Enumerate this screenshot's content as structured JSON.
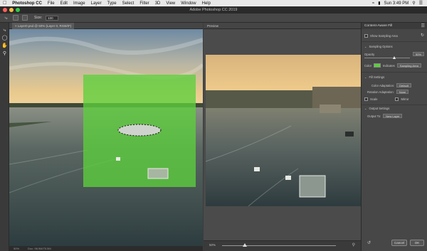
{
  "menubar": {
    "app_name": "Photoshop CC",
    "items": [
      "File",
      "Edit",
      "Image",
      "Layer",
      "Type",
      "Select",
      "Filter",
      "3D",
      "View",
      "Window",
      "Help"
    ],
    "clock": "Sun 3:49 PM"
  },
  "window": {
    "title": "Adobe Photoshop CC 2019"
  },
  "options_bar": {
    "size_label": "Size:",
    "size_value": "100"
  },
  "document": {
    "tab_label": "Layer0.psd @ 50% (Layer 0, RGB/8*)",
    "zoom": "50%",
    "doc_info": "Doc: 98.9M/75.5M"
  },
  "preview": {
    "tab_label": "Preview",
    "zoom": "50%"
  },
  "panel": {
    "title": "Content-Aware Fill",
    "show_sampling_area": "Show Sampling Area",
    "sampling_options_header": "Sampling Options",
    "opacity_label": "Opacity",
    "opacity_value": "50%",
    "color_label": "Color",
    "indicates_label": "Indicates",
    "indicates_value": "Sampling Area",
    "fill_settings_header": "Fill Settings",
    "color_adaptation_label": "Color Adaptation:",
    "color_adaptation_value": "Default",
    "rotation_adaptation_label": "Rotation Adaptation:",
    "rotation_adaptation_value": "None",
    "scale_label": "Scale",
    "mirror_label": "Mirror",
    "output_settings_header": "Output Settings",
    "output_to_label": "Output To:",
    "output_to_value": "New Layer",
    "cancel_label": "Cancel",
    "ok_label": "OK"
  },
  "colors": {
    "sampling_overlay": "#5ccf3c",
    "panel_bg": "#474747",
    "menubar_bg": "#e8e8e8"
  }
}
